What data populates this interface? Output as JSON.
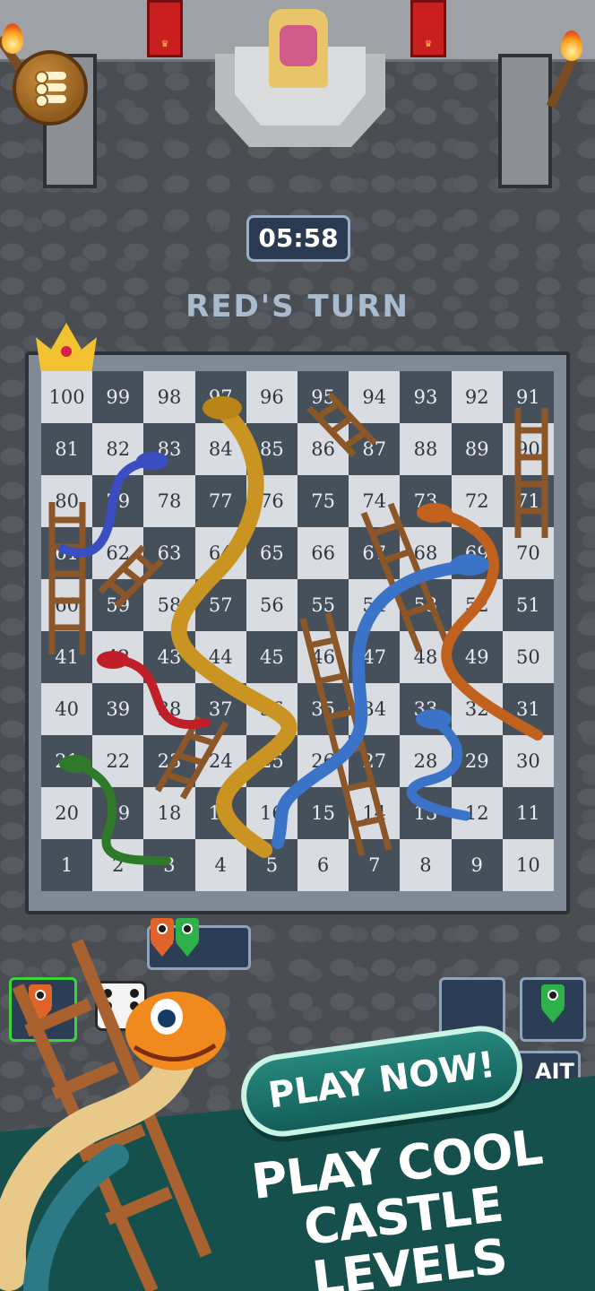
{
  "hud": {
    "timer": "05:58",
    "turn_text": "RED'S TURN",
    "wait_label": "AIT"
  },
  "board": {
    "rows": [
      [
        "100",
        "99",
        "98",
        "97",
        "96",
        "95",
        "94",
        "93",
        "92",
        "91"
      ],
      [
        "81",
        "82",
        "83",
        "84",
        "85",
        "86",
        "87",
        "88",
        "89",
        "90"
      ],
      [
        "80",
        "79",
        "78",
        "77",
        "76",
        "75",
        "74",
        "73",
        "72",
        "71"
      ],
      [
        "61",
        "62",
        "63",
        "64",
        "65",
        "66",
        "67",
        "68",
        "69",
        "70"
      ],
      [
        "60",
        "59",
        "58",
        "57",
        "56",
        "55",
        "54",
        "53",
        "52",
        "51"
      ],
      [
        "41",
        "42",
        "43",
        "44",
        "45",
        "46",
        "47",
        "48",
        "49",
        "50"
      ],
      [
        "40",
        "39",
        "38",
        "37",
        "36",
        "35",
        "34",
        "33",
        "32",
        "31"
      ],
      [
        "21",
        "22",
        "23",
        "24",
        "25",
        "26",
        "27",
        "28",
        "29",
        "30"
      ],
      [
        "20",
        "19",
        "18",
        "17",
        "16",
        "15",
        "14",
        "13",
        "12",
        "11"
      ],
      [
        "1",
        "2",
        "3",
        "4",
        "5",
        "6",
        "7",
        "8",
        "9",
        "10"
      ]
    ]
  },
  "promo": {
    "button_label": "PLAY NOW!",
    "tagline_line1": "PLAY COOL",
    "tagline_line2": "CASTLE LEVELS"
  },
  "colors": {
    "red_player": "#e0642a",
    "green_player": "#2fb14a",
    "board_light": "#d9dde2",
    "board_dark": "#46505b",
    "promo_bg": "#16504d",
    "timer_bg": "#2a3a50"
  },
  "icons": [
    "menu-icon",
    "crown-icon",
    "dice-icon",
    "flame-icon",
    "throne-icon",
    "snake-icon",
    "ladder-icon"
  ]
}
